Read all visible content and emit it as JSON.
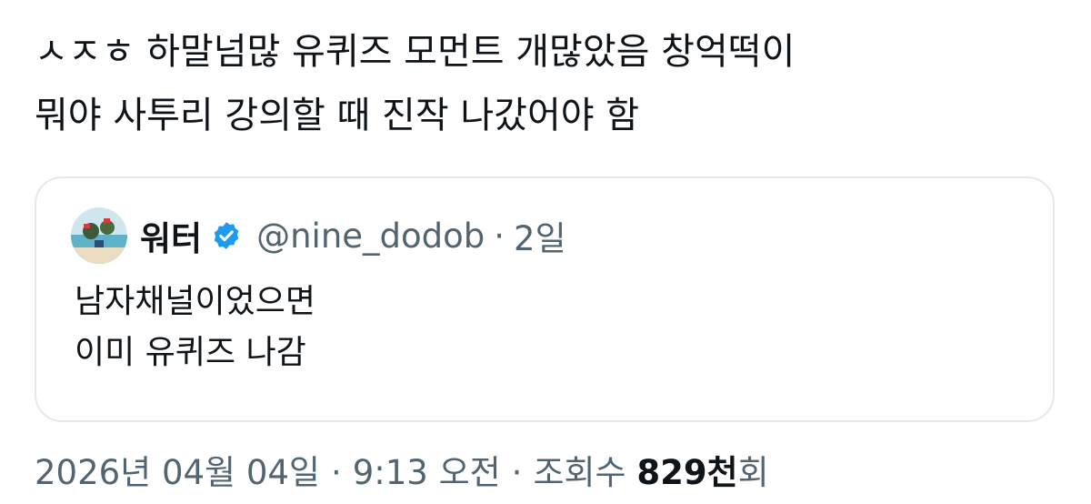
{
  "tweet": {
    "lines": [
      "ㅅㅈㅎ 하말넘많 유퀴즈 모먼트 개많았음 창억떡이",
      "뭐야 사투리 강의할 때 진작 나갔어야 함"
    ]
  },
  "quote": {
    "display_name": "워터",
    "verified": true,
    "handle": "@nine_dodob",
    "separator": "·",
    "time": "2일",
    "body_lines": [
      "남자채널이었으면",
      "이미 유퀴즈 나감"
    ]
  },
  "meta": {
    "date": "2026년 04월 04일",
    "separator": "·",
    "time": "9:13 오전",
    "views_label": "조회수",
    "views_count": "829천",
    "views_suffix": "회"
  },
  "colors": {
    "text": "#0f1419",
    "secondary": "#536471",
    "border": "#e6e9ec",
    "verified_blue": "#1d9bf0"
  },
  "icons": {
    "verified": "verified-badge-icon",
    "avatar": "avatar-image"
  }
}
